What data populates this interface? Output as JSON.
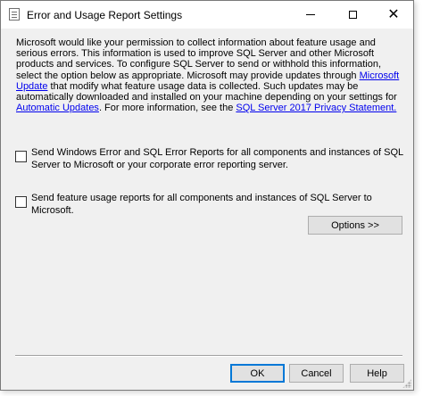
{
  "window": {
    "title": "Error and Usage Report Settings",
    "controls": {
      "minimize": "",
      "maximize": "",
      "close": "✕"
    }
  },
  "description": {
    "part1": "Microsoft would like your permission to collect information about feature usage and serious errors. This information is used to improve SQL Server and other Microsoft products and services.  To configure SQL Server to send or withhold this information, select the option below as appropriate. Microsoft may provide updates through ",
    "link_update": "Microsoft Update",
    "part2": " that modify what feature usage data is collected.  Such updates may be automatically downloaded and installed on your machine depending on your settings for ",
    "link_auto": "Automatic Updates",
    "part3": ". For more information, see the ",
    "link_privacy": "SQL Server 2017 Privacy Statement.",
    "part4": ""
  },
  "options": {
    "error_reports": {
      "label": "Send Windows Error and SQL Error Reports for all components and instances of SQL Server to Microsoft or your corporate error reporting server.",
      "checked": false
    },
    "usage_reports": {
      "label": "Send feature usage reports for all components and instances of SQL Server to Microsoft.",
      "checked": false
    }
  },
  "buttons": {
    "options": "Options >>",
    "ok": "OK",
    "cancel": "Cancel",
    "help": "Help"
  },
  "colors": {
    "link": "#0000ee",
    "default_button_border": "#0078d7",
    "dialog_bg": "#f0f0f0"
  }
}
